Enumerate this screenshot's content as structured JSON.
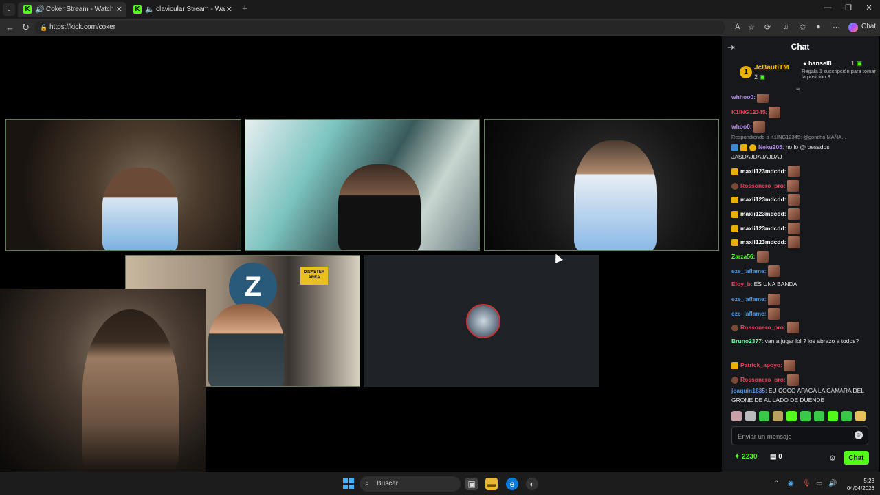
{
  "browser": {
    "tabs": [
      {
        "title": "Coker Stream - Watch Live on Kick",
        "favicon": "K",
        "audio_icon": "speaker-icon"
      },
      {
        "title": "clavicular Stream - Watch Live on Kick",
        "favicon": "K",
        "audio_icon": "speaker-muted-icon"
      }
    ],
    "url": "https://kick.com/coker",
    "copilot_label": "Chat"
  },
  "stream": {
    "cam4_sign": "DISASTER AREA",
    "cam4_logo": "Z"
  },
  "chat": {
    "title": "Chat",
    "leaderboard": {
      "first": {
        "rank": "1",
        "name": "JcBautiTM",
        "count": "2"
      },
      "second": {
        "name": "hansel8",
        "count": "1",
        "note": "Regala 1 suscripción para tomar la posición 3"
      }
    },
    "messages": [
      {
        "user": "whhoo0:",
        "color": "#b48ae8",
        "emote": true
      },
      {
        "user": "K1ING12345",
        "color": "#e8425a",
        "text": ":",
        "emote": true
      },
      {
        "user": "whoo0:",
        "color": "#b48ae8",
        "emote": true
      },
      {
        "reply": "Respondiendo a K1ING12345: @goncho MAÑA...",
        "user": "Neku205",
        "color": "#b48ae8",
        "text": ": no lo @ pesados JASDAJDAJAJDAJ"
      },
      {
        "user": "maxii123mdcdd:",
        "color": "#fff",
        "emote": true
      },
      {
        "user": "Rossonero_pro:",
        "color": "#e8425a",
        "emote": true
      },
      {
        "user": "maxii123mdcdd:",
        "color": "#fff",
        "emote": true
      },
      {
        "user": "maxii123mdcdd:",
        "color": "#fff",
        "emote": true
      },
      {
        "user": "maxii123mdcdd:",
        "color": "#fff",
        "emote": true
      },
      {
        "user": "maxii123mdcdd:",
        "color": "#fff",
        "emote": true
      },
      {
        "user": "Zarza56:",
        "color": "#53fc18",
        "emote": true
      },
      {
        "user": "eze_laflame:",
        "color": "#4a9ae8",
        "emote": true
      },
      {
        "user": "Eloy_b",
        "color": "#e8425a",
        "text": ": ES UNA BANDA"
      },
      {
        "user": "eze_laflame:",
        "color": "#4a9ae8",
        "emote": true
      },
      {
        "user": "eze_laflame:",
        "color": "#4a9ae8",
        "emote": true
      },
      {
        "user": "Rossonero_pro:",
        "color": "#e8425a",
        "emote": true
      },
      {
        "user": "Bruno2377",
        "color": "#53fc9a",
        "text": ": van a jugar lol ? los abrazo a todos?"
      },
      {
        "user": "Patrick_apoyo:",
        "color": "#e8425a",
        "emote": true
      },
      {
        "user": "Rossonero_pro:",
        "color": "#e8425a",
        "emote": true
      },
      {
        "user": "joaquin1835",
        "color": "#4a9ae8",
        "text": ": EU COCO APAGA LA CAMARA DEL GRONE DE AL LADO DE DUENDE"
      }
    ],
    "input_placeholder": "Enviar un mensaje",
    "points": "2230",
    "store_count": "0",
    "send_label": "Chat"
  },
  "taskbar": {
    "search_label": "Buscar",
    "time": "5:23",
    "date": "04/04/2026"
  },
  "colors": {
    "kick_green": "#53fc18",
    "chat_bg": "#16181c",
    "gold": "#e8b000"
  }
}
